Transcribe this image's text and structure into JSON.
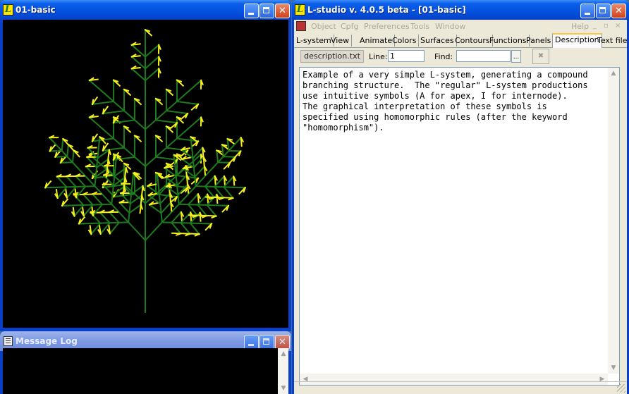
{
  "tree_window": {
    "title": "01-basic",
    "icon": "L"
  },
  "log_window": {
    "title": "Message Log"
  },
  "main_window": {
    "title": "L-studio v. 4.0.5 beta - [01-basic]",
    "icon": "L",
    "menu": [
      "Object",
      "Cpfg",
      "Preferences",
      "Tools",
      "Window"
    ],
    "help": "Help",
    "tabs": [
      "L-system",
      "View",
      "Animate",
      "Colors",
      "Surfaces",
      "Contours",
      "Functions",
      "Panels",
      "Description",
      "Text file"
    ],
    "active_tab": "Description",
    "toolbar": {
      "file": "description.txt",
      "line_label": "Line:",
      "line_value": "1",
      "find_label": "Find:",
      "find_value": "",
      "browse": "...",
      "close_glyph": "✖"
    },
    "description_lines": [
      "Example of a very simple L-system, generating a compound",
      "branching structure.  The \"regular\" L-system productions",
      "use intuitive symbols (A for apex, I for internode).",
      "The graphical interpretation of these symbols is",
      "specified using homomorphic rules (after the keyword",
      "\"homomorphism\")."
    ]
  },
  "colors": {
    "stem": "#1e7a1e",
    "apex": "#f5f01e",
    "canvas": "#000000"
  }
}
